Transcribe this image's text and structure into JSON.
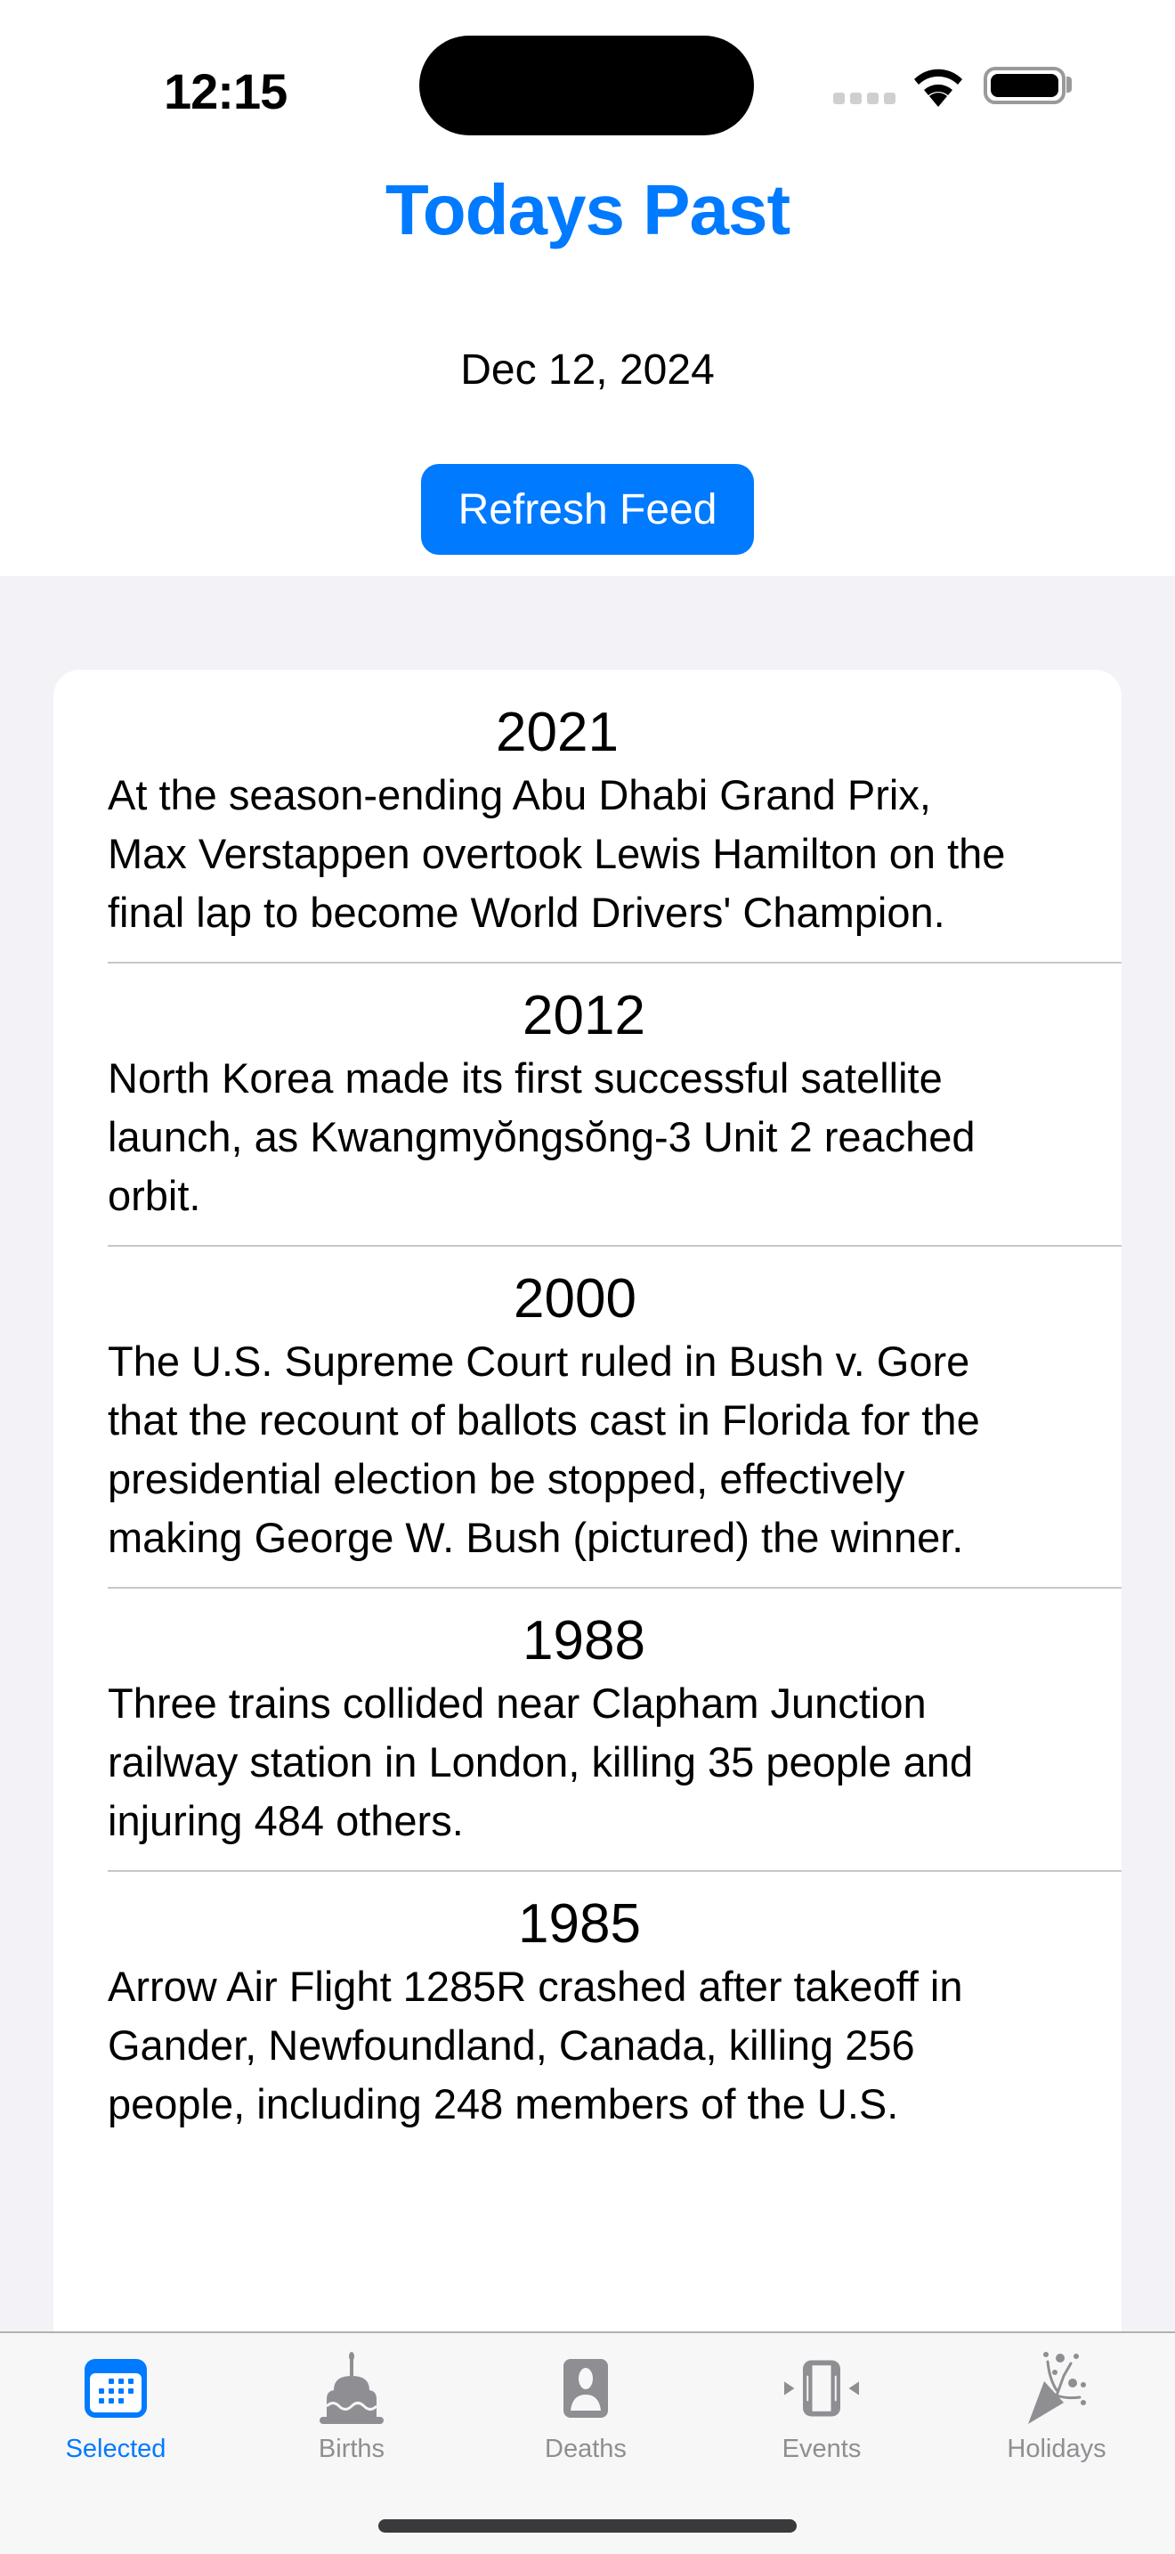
{
  "status_bar": {
    "time": "12:15",
    "icons": [
      "cellular-signal-icon",
      "wifi-icon",
      "battery-icon"
    ]
  },
  "header": {
    "title": "Todays Past",
    "date": "Dec 12, 2024",
    "refresh_label": "Refresh Feed"
  },
  "colors": {
    "accent": "#007aff",
    "background": "#f2f2f7",
    "card": "#ffffff",
    "inactive_tab": "#8e8e93"
  },
  "feed": {
    "items": [
      {
        "year": "2021",
        "text": "At the season-ending Abu Dhabi Grand Prix, Max Verstappen overtook Lewis Hamilton on the final lap to become World Drivers' Champion."
      },
      {
        "year": "2012",
        "text": "North Korea made its first successful satellite launch, as Kwangmyŏngsŏng-3 Unit 2 reached orbit."
      },
      {
        "year": "2000",
        "text": "The U.S. Supreme Court ruled in Bush v. Gore that the recount of ballots cast in Florida for the presidential election be stopped, effectively making George W. Bush (pictured) the winner."
      },
      {
        "year": "1988",
        "text": "Three trains collided near Clapham Junction railway station in London, killing 35 people and injuring 484 others."
      },
      {
        "year": "1985",
        "text": "Arrow Air Flight 1285R crashed after takeoff in Gander, Newfoundland, Canada, killing 256 people, including 248 members of the U.S."
      }
    ]
  },
  "tabs": [
    {
      "label": "Selected",
      "icon": "calendar-icon",
      "active": true
    },
    {
      "label": "Births",
      "icon": "birthday-cake-icon",
      "active": false
    },
    {
      "label": "Deaths",
      "icon": "person-portrait-icon",
      "active": false
    },
    {
      "label": "Events",
      "icon": "rectangle-compress-icon",
      "active": false
    },
    {
      "label": "Holidays",
      "icon": "party-popper-icon",
      "active": false
    }
  ]
}
